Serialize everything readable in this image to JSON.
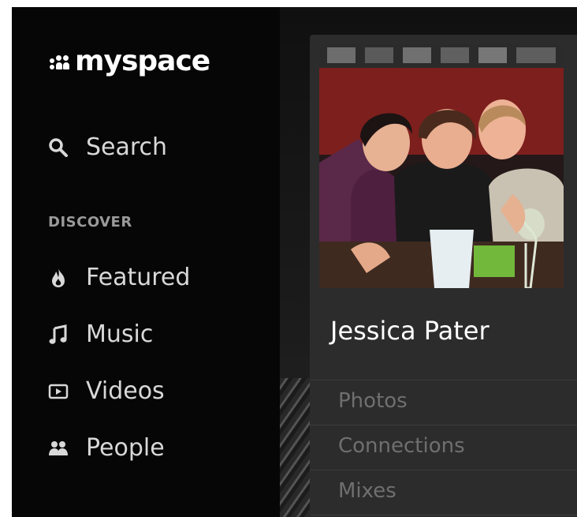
{
  "app": {
    "brand": "myspace"
  },
  "search": {
    "label": "Search"
  },
  "discover": {
    "heading": "DISCOVER",
    "items": [
      {
        "label": "Featured",
        "icon": "flame-icon"
      },
      {
        "label": "Music",
        "icon": "music-note-icon"
      },
      {
        "label": "Videos",
        "icon": "video-play-icon"
      },
      {
        "label": "People",
        "icon": "people-icon"
      }
    ]
  },
  "profile": {
    "name": "Jessica Pater",
    "links": [
      {
        "label": "Photos"
      },
      {
        "label": "Connections"
      },
      {
        "label": "Mixes"
      }
    ]
  },
  "colors": {
    "sidebar_bg": "#060606",
    "card_bg": "#2c2c2c",
    "text_primary": "#ffffff",
    "text_nav": "#d8d8d8",
    "text_muted": "#6f6f6f"
  }
}
